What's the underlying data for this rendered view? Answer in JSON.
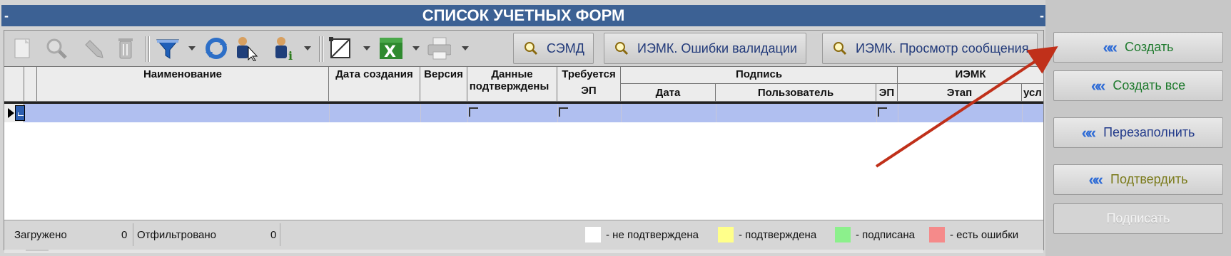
{
  "window": {
    "title": "СПИСОК УЧЕТНЫХ ФОРМ",
    "dash_left": "-",
    "dash_right": "-"
  },
  "toolbar": {
    "icons": [
      "new-doc-icon",
      "magnifier-icon",
      "pencil-icon",
      "trash-icon",
      "filter-icon",
      "refresh-icon",
      "user-cursor-icon",
      "user-info-icon",
      "frame-icon",
      "excel-icon",
      "printer-icon"
    ],
    "btn_semd": "СЭМД",
    "btn_validation": "ИЭМК. Ошибки валидации",
    "btn_message": "ИЭМК. Просмотр сообщения"
  },
  "table": {
    "headers": {
      "name": "Наименование",
      "created": "Дата создания",
      "version": "Версия",
      "confirmed_l1": "Данные",
      "confirmed_l2": "подтверждены",
      "requires_l1": "Требуется",
      "requires_l2": "ЭП",
      "signature": "Подпись",
      "sig_date": "Дата",
      "sig_user": "Пользователь",
      "sig_ep": "ЭП",
      "iemk": "ИЭМК",
      "iemk_stage": "Этап",
      "iemk_more": "усл"
    },
    "rows": [
      {
        "name": "",
        "created": "",
        "version": "",
        "confirmed": false,
        "requires_ep": false,
        "sig_date": "",
        "sig_user": "",
        "sig_ep": false,
        "iemk_stage": ""
      }
    ]
  },
  "status": {
    "loaded_label": "Загружено",
    "loaded_value": "0",
    "filtered_label": "Отфильтровано",
    "filtered_value": "0",
    "legend": [
      {
        "color": "#ffffff",
        "label": "- не подтверждена"
      },
      {
        "color": "#ffff8a",
        "label": "- подтверждена"
      },
      {
        "color": "#8cf08c",
        "label": "- подписана"
      },
      {
        "color": "#f58a8a",
        "label": "- есть ошибки"
      }
    ]
  },
  "actions": {
    "create": "Создать",
    "create_all": "Создать все",
    "refill": "Перезаполнить",
    "confirm": "Подтвердить",
    "sign": "Подписать",
    "chevron": "«",
    "colors": {
      "create": "#1f7a2e",
      "create_all": "#1f7a2e",
      "refill": "#223a8a",
      "confirm": "#7a7a1a",
      "sign_disabled": "#f4f4f4"
    }
  },
  "annotation": {
    "arrow_color": "#c0301a"
  }
}
